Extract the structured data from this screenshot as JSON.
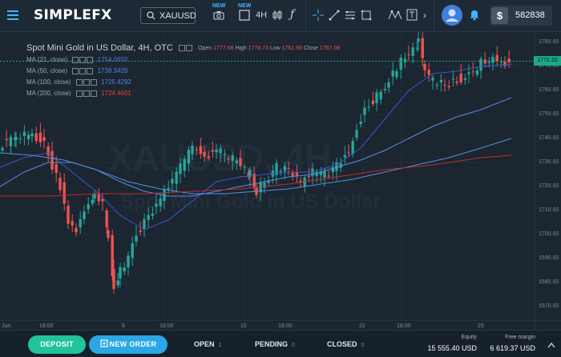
{
  "brand": {
    "name": "SIMPLEFX"
  },
  "toolbar": {
    "symbol": "XAUUSD",
    "new_tag_1": "NEW",
    "new_tag_2": "NEW",
    "timeframe": "4H",
    "tools_icons": [
      "camera-icon",
      "square-icon",
      "candles-icon",
      "function-icon",
      "crosshair-icon",
      "trendline-icon",
      "fib-icon",
      "rectangle-icon",
      "pattern-icon",
      "text-icon",
      "chevron-right-icon"
    ]
  },
  "account": {
    "balance": "582838"
  },
  "chart": {
    "title": "Spot Mini Gold in US Dollar, 4H, OTC",
    "ohlc": {
      "open_label": "Open",
      "open": "1777.68",
      "high_label": "High",
      "high": "1778.73",
      "low_label": "Low",
      "low": "1761.93",
      "close_label": "Close",
      "close": "1767.08"
    },
    "watermark_symbol": "XAUUSD, 4H",
    "watermark_name": "Spot Mini Gold in US Dollar",
    "current_price": "1772.20",
    "indicators": [
      {
        "label": "MA (21, close)",
        "value": "1754.0650",
        "color": "#5b6fd6"
      },
      {
        "label": "MA (50, close)",
        "value": "1738.3420",
        "color": "#4f86e8"
      },
      {
        "label": "MA (100, close)",
        "value": "1725.4292",
        "color": "#4f86e8"
      },
      {
        "label": "MA (200, close)",
        "value": "1724.4601",
        "color": "#ef3b3b"
      }
    ],
    "price_ticks": [
      "1780.00",
      "1770.00",
      "1760.00",
      "1750.00",
      "1740.00",
      "1730.00",
      "1720.00",
      "1710.00",
      "1700.00",
      "1690.00",
      "1680.00",
      "1670.00"
    ],
    "time_ticks": [
      "Jun",
      "18:00",
      "8",
      "18:00",
      "15",
      "18:00",
      "22",
      "18:00",
      "29"
    ],
    "colors": {
      "up": "#26a69a",
      "down": "#ef5350",
      "ma21": "#3f55c8",
      "ma50": "#5a8ce0",
      "ma200": "#c42b2b"
    }
  },
  "bottom": {
    "deposit": "DEPOSIT",
    "new_order": "NEW ORDER",
    "tabs": [
      {
        "label": "OPEN",
        "count": "1"
      },
      {
        "label": "PENDING",
        "count": "0"
      },
      {
        "label": "CLOSED",
        "count": "0"
      }
    ],
    "equity_label": "Equity",
    "equity_value": "15 555.40 USD",
    "free_margin_label": "Free margin",
    "free_margin_value": "6 619.37 USD"
  }
}
